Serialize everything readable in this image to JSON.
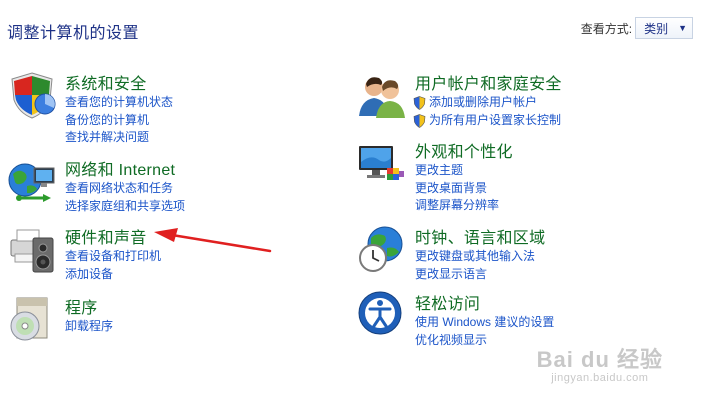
{
  "header": {
    "title": "调整计算机的设置",
    "view_by_label": "查看方式:",
    "view_by_value": "类别"
  },
  "categories": [
    {
      "title": "系统和安全",
      "icon": "shield-icon",
      "links": [
        {
          "label": "查看您的计算机状态"
        },
        {
          "label": "备份您的计算机"
        },
        {
          "label": "查找并解决问题"
        }
      ]
    },
    {
      "title": "网络和 Internet",
      "icon": "network-globe-icon",
      "links": [
        {
          "label": "查看网络状态和任务"
        },
        {
          "label": "选择家庭组和共享选项"
        }
      ]
    },
    {
      "title": "硬件和声音",
      "icon": "printer-speaker-icon",
      "links": [
        {
          "label": "查看设备和打印机"
        },
        {
          "label": "添加设备"
        }
      ]
    },
    {
      "title": "程序",
      "icon": "programs-disc-icon",
      "links": [
        {
          "label": "卸载程序"
        }
      ]
    },
    {
      "title": "用户帐户和家庭安全",
      "icon": "users-icon",
      "links": [
        {
          "label": "添加或删除用户帐户",
          "shield": true
        },
        {
          "label": "为所有用户设置家长控制",
          "shield": true
        }
      ]
    },
    {
      "title": "外观和个性化",
      "icon": "monitor-paint-icon",
      "links": [
        {
          "label": "更改主题"
        },
        {
          "label": "更改桌面背景"
        },
        {
          "label": "调整屏幕分辨率"
        }
      ]
    },
    {
      "title": "时钟、语言和区域",
      "icon": "clock-globe-icon",
      "links": [
        {
          "label": "更改键盘或其他输入法"
        },
        {
          "label": "更改显示语言"
        }
      ]
    },
    {
      "title": "轻松访问",
      "icon": "ease-of-access-icon",
      "links": [
        {
          "label": "使用 Windows 建议的设置"
        },
        {
          "label": "优化视频显示"
        }
      ]
    }
  ],
  "annotation": {
    "arrow_color": "#e02020"
  },
  "watermark": {
    "logo": "Bai du 经验",
    "url": "jingyan.baidu.com"
  }
}
